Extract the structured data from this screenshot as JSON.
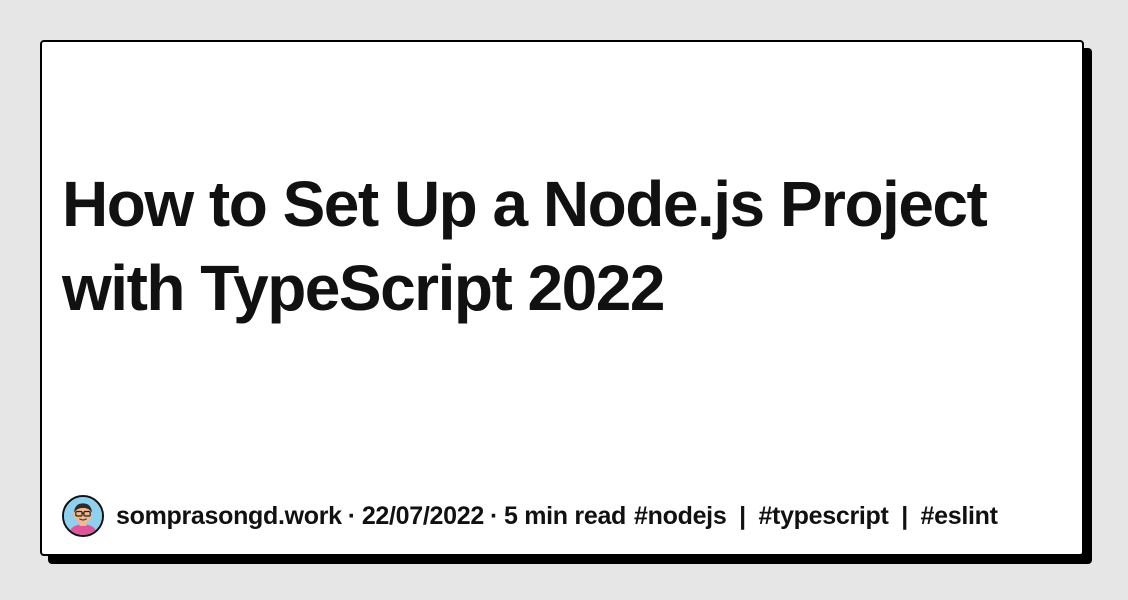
{
  "card": {
    "title": "How to Set Up a Node.js Project with TypeScript 2022"
  },
  "footer": {
    "avatar_icon": "user-avatar-icon",
    "author": "somprasongd.work",
    "separator": "·",
    "date": "22/07/2022",
    "read_time": "5 min read",
    "tags": [
      "#nodejs",
      "#typescript",
      "#eslint"
    ],
    "tag_separator": "|"
  },
  "colors": {
    "background": "#e6e6e6",
    "card": "#ffffff",
    "text": "#111111",
    "shadow": "#000000"
  }
}
